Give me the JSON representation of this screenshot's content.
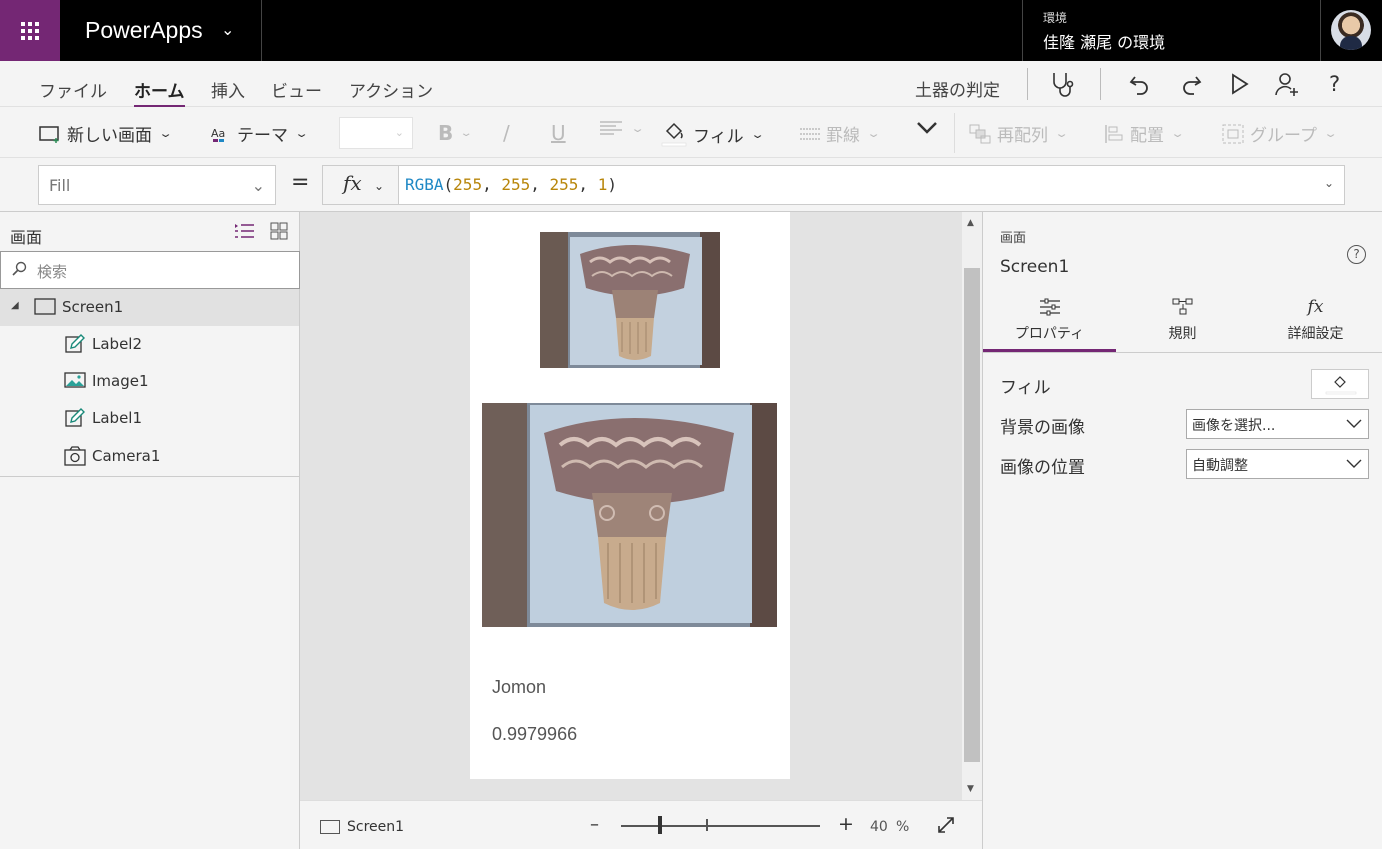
{
  "topbar": {
    "app_name": "PowerApps",
    "environment_label": "環境",
    "environment_value": "佳隆 瀬尾 の環境"
  },
  "menubar": {
    "tabs": [
      "ファイル",
      "ホーム",
      "挿入",
      "ビュー",
      "アクション"
    ],
    "active_tab": "ホーム",
    "app_title": "土器の判定"
  },
  "ribbon": {
    "new_screen": "新しい画面",
    "theme": "テーマ",
    "bold": "B",
    "italic": "/",
    "underline": "U",
    "fill": "フィル",
    "border": "罫線",
    "reorder": "再配列",
    "align": "配置",
    "group": "グループ"
  },
  "formulabar": {
    "property": "Fill",
    "equals": "=",
    "fx": "fx",
    "formula_fn": "RGBA",
    "formula_args": [
      "255",
      "255",
      "255",
      "1"
    ]
  },
  "leftpanel": {
    "title": "画面",
    "search_placeholder": "検索",
    "tree": [
      {
        "label": "Screen1",
        "icon": "screen-icon",
        "level": 0,
        "selected": true
      },
      {
        "label": "Label2",
        "icon": "label-icon",
        "level": 1
      },
      {
        "label": "Image1",
        "icon": "image-icon",
        "level": 1
      },
      {
        "label": "Label1",
        "icon": "label-icon",
        "level": 1
      },
      {
        "label": "Camera1",
        "icon": "camera-icon",
        "level": 1
      }
    ]
  },
  "canvas": {
    "label_class": "Jomon",
    "label_score": "0.9979966"
  },
  "statusbar": {
    "screen_name": "Screen1",
    "zoom_value": "40",
    "zoom_unit": "%",
    "zoom_fraction": 0.4
  },
  "rightpanel": {
    "type": "画面",
    "name": "Screen1",
    "tabs": [
      "プロパティ",
      "規則",
      "詳細設定"
    ],
    "active_tab": "プロパティ",
    "props": {
      "fill_label": "フィル",
      "bg_image_label": "背景の画像",
      "bg_image_value": "画像を選択...",
      "image_pos_label": "画像の位置",
      "image_pos_value": "自動調整"
    }
  },
  "colors": {
    "brand": "#742774",
    "formula_fn": "#1f88c5",
    "formula_num": "#b8860b"
  }
}
